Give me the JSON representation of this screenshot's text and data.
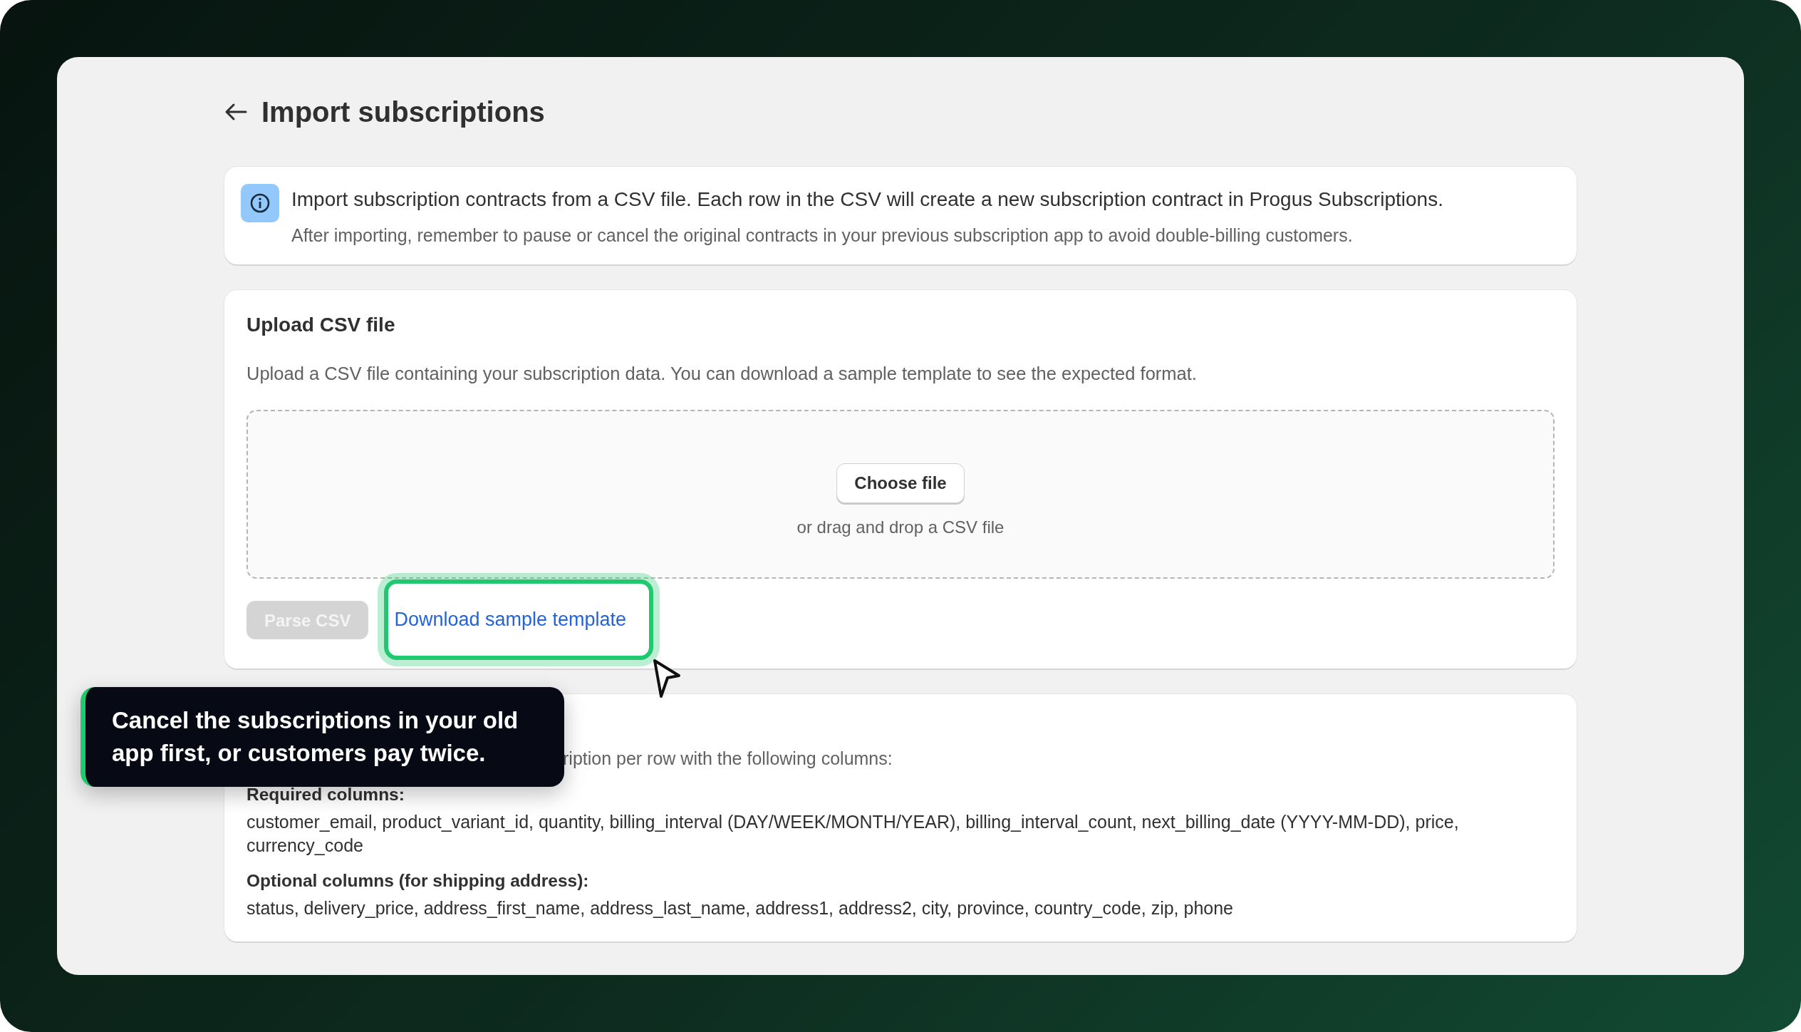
{
  "page": {
    "title": "Import subscriptions"
  },
  "notice": {
    "message": "Import subscription contracts from a CSV file. Each row in the CSV will create a new subscription contract in Progus Subscriptions.",
    "detail": "After importing, remember to pause or cancel the original contracts in your previous subscription app to avoid double-billing customers."
  },
  "upload": {
    "title": "Upload CSV file",
    "description": "Upload a CSV file containing your subscription data. You can download a sample template to see the expected format.",
    "choose_button": "Choose file",
    "drop_hint": "or drag and drop a CSV file",
    "parse_button": {
      "label": "Parse CSV",
      "disabled": true
    },
    "template_link": {
      "label": "Download sample template",
      "highlighted": true
    }
  },
  "format": {
    "description_fragment": "ription per row with the following columns:",
    "sections": [
      {
        "heading": "Required columns:",
        "text": "customer_email, product_variant_id, quantity, billing_interval (DAY/WEEK/MONTH/YEAR), billing_interval_count, next_billing_date (YYYY-MM-DD), price, currency_code"
      },
      {
        "heading": "Optional columns (for shipping address):",
        "text": "status, delivery_price, address_first_name, address_last_name, address1, address2, city, province, country_code, zip, phone"
      }
    ]
  },
  "callout": {
    "text": "Cancel the subscriptions in your old app first, or customers pay twice."
  }
}
